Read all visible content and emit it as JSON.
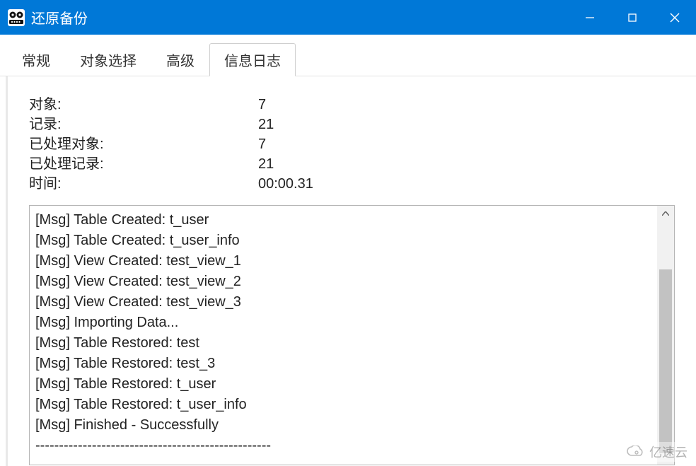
{
  "window": {
    "title": "还原备份"
  },
  "tabs": [
    {
      "label": "常规"
    },
    {
      "label": "对象选择"
    },
    {
      "label": "高级"
    },
    {
      "label": "信息日志",
      "active": true
    }
  ],
  "stats": {
    "objects_label": "对象:",
    "objects_value": "7",
    "records_label": "记录:",
    "records_value": "21",
    "processed_objects_label": "已处理对象:",
    "processed_objects_value": "7",
    "processed_records_label": "已处理记录:",
    "processed_records_value": "21",
    "time_label": "时间:",
    "time_value": "00:00.31"
  },
  "log": {
    "lines": [
      "[Msg] Table Created: t_user",
      "[Msg] Table Created: t_user_info",
      "[Msg] View Created: test_view_1",
      "[Msg] View Created: test_view_2",
      "[Msg] View Created: test_view_3",
      "[Msg] Importing Data...",
      "[Msg] Table Restored: test",
      "[Msg] Table Restored: test_3",
      "[Msg] Table Restored: t_user",
      "[Msg] Table Restored: t_user_info",
      "[Msg] Finished - Successfully",
      "--------------------------------------------------"
    ]
  },
  "watermark": {
    "text": "亿速云"
  }
}
